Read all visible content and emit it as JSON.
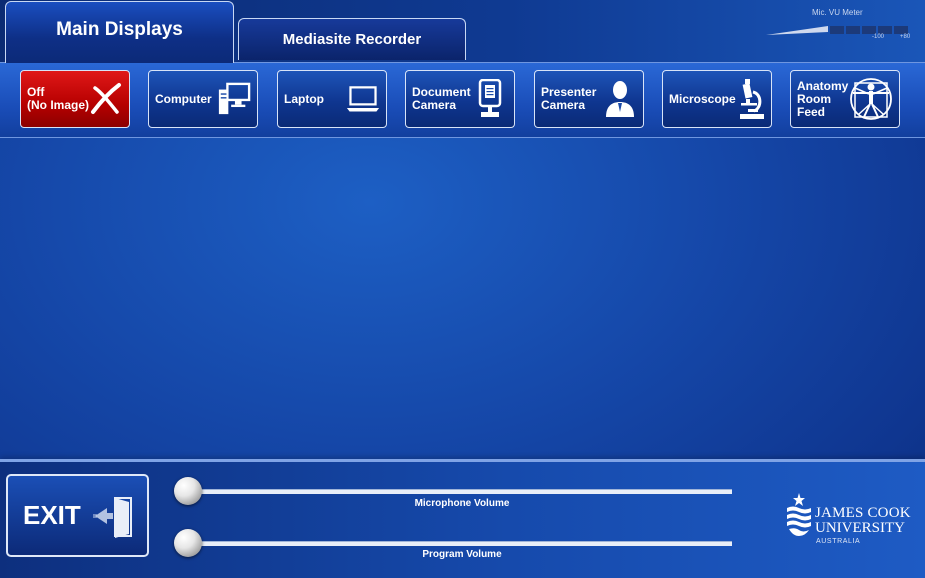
{
  "tabs": [
    {
      "label": "Main Displays",
      "active": true
    },
    {
      "label": "Mediasite Recorder",
      "active": false
    }
  ],
  "vu_meter": {
    "title": "Mic. VU Meter",
    "low_label": "-100",
    "high_label": "+80",
    "segments_lit": 3,
    "segments_total": 7
  },
  "sources": [
    {
      "label": "Off\n(No Image)",
      "icon": "x-mark-icon",
      "state": "selected"
    },
    {
      "label": "Computer",
      "icon": "desktop-computer-icon"
    },
    {
      "label": "Laptop",
      "icon": "laptop-icon"
    },
    {
      "label": "Document\nCamera",
      "icon": "document-camera-icon"
    },
    {
      "label": "Presenter\nCamera",
      "icon": "presenter-person-icon"
    },
    {
      "label": "Microscope",
      "icon": "microscope-icon"
    },
    {
      "label": "Anatomy\nRoom\nFeed",
      "icon": "vitruvian-man-icon"
    }
  ],
  "exit": {
    "label": "EXIT",
    "icon": "exit-door-icon"
  },
  "sliders": [
    {
      "label": "Microphone Volume",
      "level": 0.0
    },
    {
      "label": "Program Volume",
      "level": 0.0
    }
  ],
  "logo": {
    "line1": "JAMES COOK",
    "line2": "UNIVERSITY",
    "line3": "AUSTRALIA"
  },
  "colors": {
    "accent_blue": "#1547a8",
    "off_red": "#c00000",
    "border": "#d8e4f8"
  }
}
